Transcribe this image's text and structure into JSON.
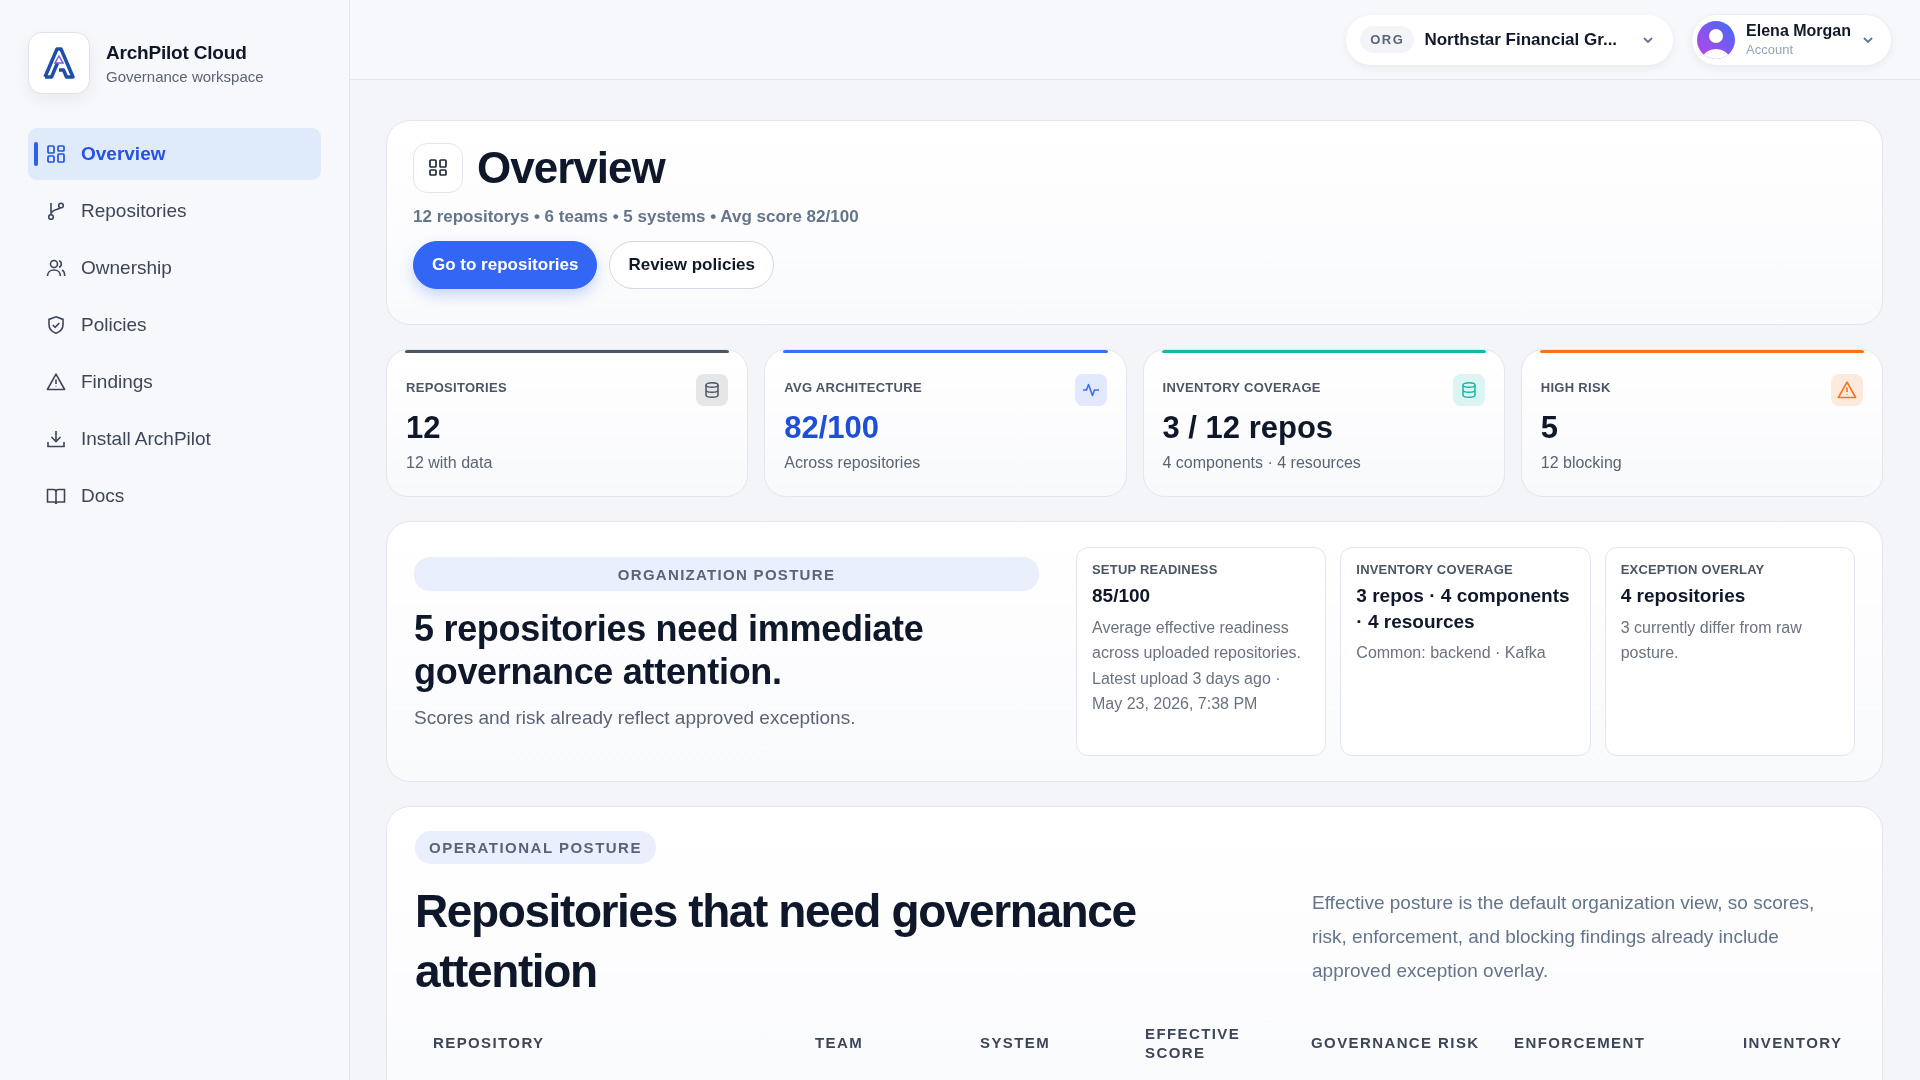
{
  "brand": {
    "name": "ArchPilot Cloud",
    "subtitle": "Governance workspace"
  },
  "nav": [
    {
      "label": "Overview",
      "selected": true
    },
    {
      "label": "Repositories",
      "selected": false
    },
    {
      "label": "Ownership",
      "selected": false
    },
    {
      "label": "Policies",
      "selected": false
    },
    {
      "label": "Findings",
      "selected": false
    },
    {
      "label": "Install ArchPilot",
      "selected": false
    },
    {
      "label": "Docs",
      "selected": false
    }
  ],
  "header": {
    "org": {
      "badge": "ORG",
      "name": "Northstar Financial Gr..."
    },
    "user": {
      "name": "Elena Morgan",
      "role": "Account"
    }
  },
  "page": {
    "title": "Overview",
    "summary": "12 repositorys • 6 teams • 5 systems • Avg score 82/100",
    "buttons": [
      {
        "label": "Go to repositories",
        "kind": "primary"
      },
      {
        "label": "Review policies",
        "kind": "secondary"
      }
    ]
  },
  "stats": [
    {
      "label": "REPOSITORIES",
      "value": "12",
      "note": "12 with data",
      "color": "#4b5563",
      "highlight": false
    },
    {
      "label": "AVG ARCHITECTURE",
      "value": "82/100",
      "note": "Across repositories",
      "color": "#3b6ef6",
      "highlight": true
    },
    {
      "label": "INVENTORY COVERAGE",
      "value": "3 / 12 repos",
      "note": "4 components · 4 resources",
      "color": "#14b8a6",
      "highlight": false
    },
    {
      "label": "HIGH RISK",
      "value": "5",
      "note": "12 blocking",
      "color": "#f97316",
      "highlight": false
    }
  ],
  "posture": {
    "tag": "ORGANIZATION POSTURE",
    "headline": "5 repositories need immediate governance attention.",
    "note": "Scores and risk already reflect approved exceptions.",
    "cards": [
      {
        "label": "SETUP READINESS",
        "value": "85/100",
        "text": "Average effective readiness across uploaded repositories. Latest upload 3 days ago · May 23, 2026, 7:38 PM"
      },
      {
        "label": "INVENTORY COVERAGE",
        "value": "3 repos · 4 components · 4 resources",
        "text": "Common: backend · Kafka"
      },
      {
        "label": "EXCEPTION OVERLAY",
        "value": "4 repositories",
        "text": "3 currently differ from raw posture."
      }
    ]
  },
  "operations": {
    "tag": "OPERATIONAL POSTURE",
    "heading": "Repositories that need governance attention",
    "description": "Effective posture is the default organization view, so scores, risk, enforcement, and blocking findings already include approved exception overlay.",
    "columns": [
      "REPOSITORY",
      "TEAM",
      "SYSTEM",
      "EFFECTIVE SCORE",
      "GOVERNANCE RISK",
      "ENFORCEMENT",
      "INVENTORY"
    ]
  }
}
